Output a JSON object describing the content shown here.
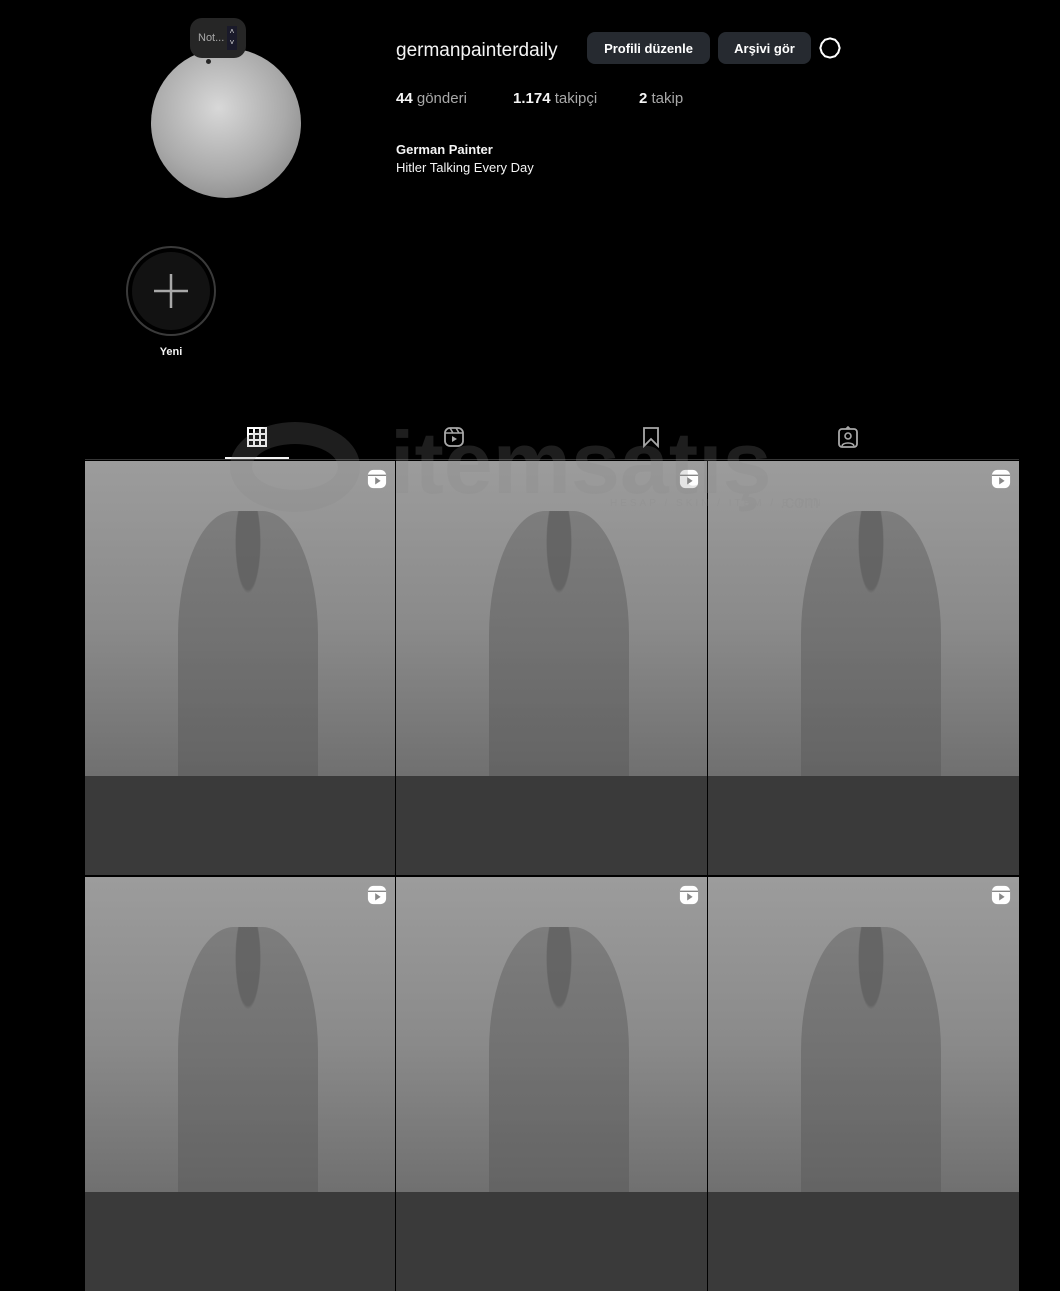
{
  "note": {
    "label": "Not..."
  },
  "profile": {
    "username": "germanpainterdaily",
    "edit_button": "Profili düzenle",
    "archive_button": "Arşivi gör",
    "stats": [
      {
        "count": "44",
        "label": "gönderi"
      },
      {
        "count": "1.174",
        "label": "takipçi"
      },
      {
        "count": "2",
        "label": "takip"
      }
    ],
    "bio_name": "German Painter",
    "bio_text": "Hitler Talking Every Day"
  },
  "highlight": {
    "label": "Yeni"
  },
  "tabs": [
    "posts-grid",
    "reels",
    "saved",
    "tagged"
  ],
  "watermark": {
    "brand": "itemsatış",
    "tagline": "HESAP / SKIN / ITEM / E-PIN",
    "suffix": ".com"
  },
  "posts": [
    {
      "type": "reel"
    },
    {
      "type": "reel"
    },
    {
      "type": "reel"
    },
    {
      "type": "reel"
    },
    {
      "type": "reel"
    },
    {
      "type": "reel"
    }
  ]
}
